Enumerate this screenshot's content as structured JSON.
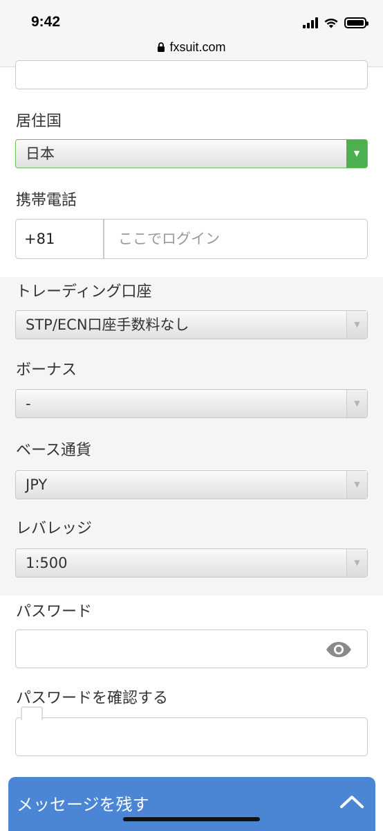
{
  "status_bar": {
    "time": "9:42"
  },
  "browser": {
    "url": "fxsuit.com",
    "lock_icon": "lock-icon"
  },
  "form": {
    "country": {
      "label": "居住国",
      "value": "日本"
    },
    "phone": {
      "label": "携帯電話",
      "code": "+81",
      "placeholder": "ここでログイン"
    },
    "trading_account": {
      "label": "トレーディング口座",
      "value": "STP/ECN口座手数料なし"
    },
    "bonus": {
      "label": "ボーナス",
      "value": "-"
    },
    "base_currency": {
      "label": "ベース通貨",
      "value": "JPY"
    },
    "leverage": {
      "label": "レバレッジ",
      "value": "1:500"
    },
    "password": {
      "label": "パスワード",
      "toggle_icon": "eye-icon"
    },
    "password_confirm": {
      "label": "パスワードを確認する"
    }
  },
  "chat_widget": {
    "label": "メッセージを残す",
    "icon": "chevron-up-icon"
  },
  "colors": {
    "accent_green": "#4caf50",
    "chat_blue": "#4a86d4",
    "band_grey": "#f4f5f7"
  }
}
